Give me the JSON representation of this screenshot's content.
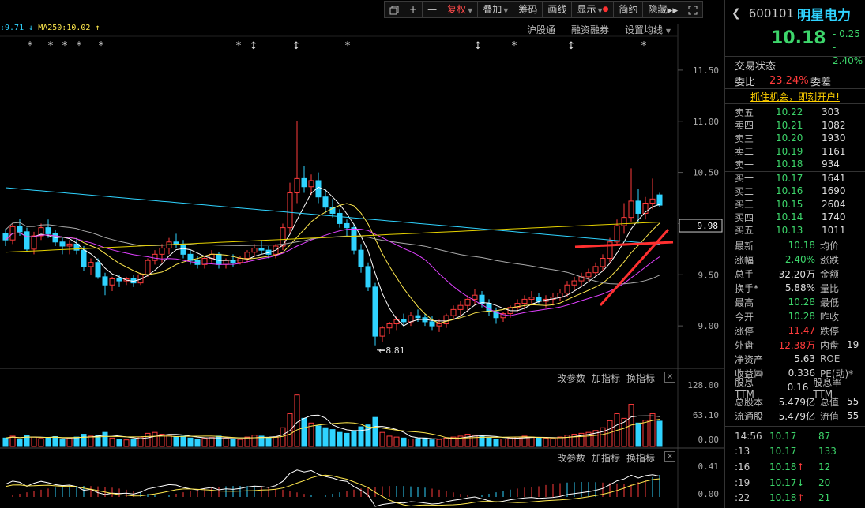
{
  "toolbar": {
    "restore_icon": "restore-window-icon",
    "zoom_in": "+",
    "zoom_out": "—",
    "fuquan": "复权",
    "diejia": "叠加",
    "chouma": "筹码",
    "huaxian": "画线",
    "xianshi": "显示",
    "jianyue": "简约",
    "yincang": "隐藏",
    "fullscreen_icon": "fullscreen-icon"
  },
  "ma_legend": {
    "ma_prefix": ":9.71",
    "ma_arrow": "↓",
    "ma250": "MA250:10.02",
    "ma250_arrow": "↑"
  },
  "links": {
    "hgt": "沪股通",
    "rzrq": "融资融券",
    "szjx": "设置均线"
  },
  "price_axis": [
    "11.50",
    "11.00",
    "10.50",
    "10.00",
    "9.50",
    "9.00"
  ],
  "current_price_tag": "9.98",
  "low_label": "8.81",
  "sub_buttons": {
    "params": "改参数",
    "add": "加指标",
    "switch": "换指标",
    "close": "×"
  },
  "vol_axis": [
    "128.00",
    "63.10",
    "0.00"
  ],
  "macd_axis": [
    "0.41",
    "0.00"
  ],
  "stock": {
    "code": "600101",
    "name": "明星电力",
    "price": "10.18",
    "change": "- 0.25",
    "change_pct": "- 2.40%"
  },
  "panel": {
    "trade_status_label": "交易状态",
    "weibi_label": "委比",
    "weibi": "23.24%",
    "weicha_label": "委差",
    "promo": "抓住机会，即刻开户!",
    "sells": [
      {
        "label": "卖五",
        "price": "10.22",
        "vol": "303"
      },
      {
        "label": "卖四",
        "price": "10.21",
        "vol": "1082"
      },
      {
        "label": "卖三",
        "price": "10.20",
        "vol": "1930"
      },
      {
        "label": "卖二",
        "price": "10.19",
        "vol": "1161"
      },
      {
        "label": "卖一",
        "price": "10.18",
        "vol": "934"
      }
    ],
    "buys": [
      {
        "label": "买一",
        "price": "10.17",
        "vol": "1641"
      },
      {
        "label": "买二",
        "price": "10.16",
        "vol": "1690"
      },
      {
        "label": "买三",
        "price": "10.15",
        "vol": "2604"
      },
      {
        "label": "买四",
        "price": "10.14",
        "vol": "1740"
      },
      {
        "label": "买五",
        "price": "10.13",
        "vol": "1011"
      }
    ],
    "stats": [
      {
        "k1": "最新",
        "v1": "10.18",
        "c": "green",
        "k2": "均价"
      },
      {
        "k1": "涨幅",
        "v1": "-2.40%",
        "c": "green",
        "k2": "涨跌"
      },
      {
        "k1": "总手",
        "v1": "32.20万",
        "c": "white",
        "k2": "金额"
      },
      {
        "k1": "换手*",
        "v1": "5.88%",
        "c": "white",
        "k2": "量比"
      },
      {
        "k1": "最高",
        "v1": "10.28",
        "c": "green",
        "k2": "最低"
      },
      {
        "k1": "今开",
        "v1": "10.28",
        "c": "green",
        "k2": "昨收"
      },
      {
        "k1": "涨停",
        "v1": "11.47",
        "c": "red",
        "k2": "跌停"
      },
      {
        "k1": "外盘",
        "v1": "12.38万",
        "c": "red",
        "k2": "内盘"
      },
      {
        "k1": "净资产",
        "v1": "5.63",
        "c": "white",
        "k2": "ROE"
      },
      {
        "k1": "收益㈣",
        "v1": "0.336",
        "c": "white",
        "k2": "PE(动)*"
      },
      {
        "k1": "股息TTM",
        "v1": "0.16",
        "c": "white",
        "k2": "股息率TTM"
      },
      {
        "k1": "总股本",
        "v1": "5.479亿",
        "c": "white",
        "k2": "总值"
      },
      {
        "k1": "流通股",
        "v1": "5.479亿",
        "c": "white",
        "k2": "流值"
      }
    ],
    "stat_tail": [
      "",
      "",
      "",
      "",
      "",
      "",
      "",
      "19",
      "",
      "",
      "",
      "55",
      "55"
    ],
    "ticks": [
      {
        "t": "14:56",
        "p": "10.17",
        "v": "87",
        "arrow": ""
      },
      {
        "t": ":13",
        "p": "10.17",
        "v": "133",
        "arrow": ""
      },
      {
        "t": ":16",
        "p": "10.18",
        "v": "12",
        "arrow": "↑"
      },
      {
        "t": ":19",
        "p": "10.17",
        "v": "20",
        "arrow": "↓"
      },
      {
        "t": ":22",
        "p": "10.18",
        "v": "21",
        "arrow": "↑"
      }
    ]
  },
  "chart_data": {
    "type": "candlestick",
    "price_range": [
      8.6,
      11.8
    ],
    "candles": [
      [
        9.9,
        9.95,
        9.78,
        9.84
      ],
      [
        9.84,
        10.0,
        9.8,
        9.97
      ],
      [
        9.97,
        10.05,
        9.88,
        9.92
      ],
      [
        9.92,
        9.96,
        9.72,
        9.75
      ],
      [
        9.75,
        9.92,
        9.7,
        9.88
      ],
      [
        9.88,
        10.0,
        9.84,
        9.96
      ],
      [
        9.96,
        10.04,
        9.86,
        9.9
      ],
      [
        9.9,
        9.94,
        9.78,
        9.82
      ],
      [
        9.82,
        9.86,
        9.7,
        9.78
      ],
      [
        9.78,
        9.84,
        9.7,
        9.8
      ],
      [
        9.8,
        9.86,
        9.7,
        9.74
      ],
      [
        9.74,
        9.78,
        9.54,
        9.58
      ],
      [
        9.58,
        9.66,
        9.5,
        9.62
      ],
      [
        9.62,
        9.66,
        9.46,
        9.48
      ],
      [
        9.48,
        9.52,
        9.3,
        9.4
      ],
      [
        9.4,
        9.48,
        9.34,
        9.46
      ],
      [
        9.46,
        9.5,
        9.38,
        9.44
      ],
      [
        9.44,
        9.48,
        9.4,
        9.46
      ],
      [
        9.46,
        9.5,
        9.38,
        9.42
      ],
      [
        9.42,
        9.52,
        9.4,
        9.5
      ],
      [
        9.5,
        9.66,
        9.48,
        9.64
      ],
      [
        9.64,
        9.74,
        9.6,
        9.7
      ],
      [
        9.7,
        9.8,
        9.62,
        9.76
      ],
      [
        9.76,
        9.86,
        9.7,
        9.82
      ],
      [
        9.82,
        9.9,
        9.76,
        9.8
      ],
      [
        9.8,
        9.84,
        9.66,
        9.7
      ],
      [
        9.7,
        9.74,
        9.6,
        9.64
      ],
      [
        9.64,
        9.68,
        9.56,
        9.6
      ],
      [
        9.6,
        9.68,
        9.56,
        9.66
      ],
      [
        9.66,
        9.74,
        9.62,
        9.7
      ],
      [
        9.7,
        9.72,
        9.56,
        9.6
      ],
      [
        9.6,
        9.66,
        9.56,
        9.64
      ],
      [
        9.64,
        9.7,
        9.58,
        9.62
      ],
      [
        9.62,
        9.68,
        9.6,
        9.66
      ],
      [
        9.66,
        9.74,
        9.62,
        9.72
      ],
      [
        9.72,
        9.8,
        9.68,
        9.76
      ],
      [
        9.76,
        9.84,
        9.7,
        9.74
      ],
      [
        9.74,
        9.78,
        9.66,
        9.7
      ],
      [
        9.7,
        9.8,
        9.66,
        9.78
      ],
      [
        9.78,
        10.0,
        9.74,
        9.96
      ],
      [
        9.96,
        10.4,
        9.9,
        10.3
      ],
      [
        10.3,
        11.0,
        10.2,
        10.44
      ],
      [
        10.44,
        10.56,
        10.3,
        10.36
      ],
      [
        10.36,
        10.48,
        10.28,
        10.42
      ],
      [
        10.42,
        10.5,
        10.2,
        10.26
      ],
      [
        10.26,
        10.34,
        10.1,
        10.16
      ],
      [
        10.16,
        10.24,
        10.06,
        10.1
      ],
      [
        10.1,
        10.14,
        9.96,
        10.0
      ],
      [
        10.0,
        10.04,
        9.88,
        9.96
      ],
      [
        9.96,
        10.0,
        9.7,
        9.74
      ],
      [
        9.74,
        9.8,
        9.52,
        9.58
      ],
      [
        9.58,
        9.62,
        9.34,
        9.38
      ],
      [
        9.38,
        9.42,
        8.81,
        8.9
      ],
      [
        8.9,
        9.0,
        8.84,
        8.98
      ],
      [
        8.98,
        9.04,
        8.92,
        9.02
      ],
      [
        9.02,
        9.1,
        8.96,
        9.06
      ],
      [
        9.06,
        9.12,
        9.0,
        9.04
      ],
      [
        9.04,
        9.14,
        9.0,
        9.1
      ],
      [
        9.1,
        9.16,
        9.04,
        9.08
      ],
      [
        9.08,
        9.12,
        9.0,
        9.04
      ],
      [
        9.04,
        9.1,
        8.96,
        9.0
      ],
      [
        9.0,
        9.06,
        8.94,
        9.02
      ],
      [
        9.02,
        9.12,
        8.98,
        9.1
      ],
      [
        9.1,
        9.2,
        9.06,
        9.16
      ],
      [
        9.16,
        9.24,
        9.1,
        9.2
      ],
      [
        9.2,
        9.3,
        9.14,
        9.26
      ],
      [
        9.26,
        9.36,
        9.2,
        9.3
      ],
      [
        9.3,
        9.34,
        9.18,
        9.22
      ],
      [
        9.22,
        9.26,
        9.1,
        9.14
      ],
      [
        9.14,
        9.18,
        9.02,
        9.08
      ],
      [
        9.08,
        9.14,
        9.04,
        9.12
      ],
      [
        9.12,
        9.2,
        9.08,
        9.18
      ],
      [
        9.18,
        9.26,
        9.14,
        9.22
      ],
      [
        9.22,
        9.3,
        9.16,
        9.26
      ],
      [
        9.26,
        9.34,
        9.2,
        9.28
      ],
      [
        9.28,
        9.32,
        9.22,
        9.24
      ],
      [
        9.24,
        9.3,
        9.18,
        9.26
      ],
      [
        9.26,
        9.32,
        9.2,
        9.28
      ],
      [
        9.28,
        9.36,
        9.24,
        9.32
      ],
      [
        9.32,
        9.44,
        9.28,
        9.4
      ],
      [
        9.4,
        9.48,
        9.34,
        9.44
      ],
      [
        9.44,
        9.52,
        9.38,
        9.48
      ],
      [
        9.48,
        9.56,
        9.44,
        9.52
      ],
      [
        9.52,
        9.62,
        9.48,
        9.58
      ],
      [
        9.58,
        9.7,
        9.54,
        9.66
      ],
      [
        9.66,
        9.86,
        9.62,
        9.82
      ],
      [
        9.82,
        10.04,
        9.78,
        9.98
      ],
      [
        9.98,
        10.2,
        9.9,
        10.06
      ],
      [
        10.06,
        10.54,
        10.02,
        10.22
      ],
      [
        10.22,
        10.34,
        10.0,
        10.1
      ],
      [
        10.1,
        10.26,
        10.04,
        10.2
      ],
      [
        10.2,
        10.44,
        10.14,
        10.24
      ],
      [
        10.28,
        10.3,
        10.16,
        10.18
      ]
    ],
    "volumes": [
      18,
      22,
      16,
      24,
      20,
      17,
      19,
      21,
      15,
      18,
      20,
      26,
      22,
      24,
      30,
      18,
      16,
      14,
      15,
      20,
      28,
      30,
      26,
      24,
      20,
      22,
      18,
      16,
      17,
      19,
      22,
      18,
      16,
      15,
      20,
      24,
      22,
      18,
      20,
      40,
      70,
      110,
      60,
      50,
      44,
      40,
      36,
      30,
      28,
      34,
      42,
      46,
      62,
      30,
      22,
      20,
      18,
      16,
      17,
      18,
      14,
      15,
      18,
      20,
      22,
      26,
      24,
      22,
      18,
      16,
      16,
      18,
      20,
      22,
      20,
      18,
      17,
      18,
      20,
      24,
      26,
      28,
      30,
      34,
      40,
      55,
      70,
      60,
      90,
      50,
      56,
      70,
      54
    ]
  }
}
